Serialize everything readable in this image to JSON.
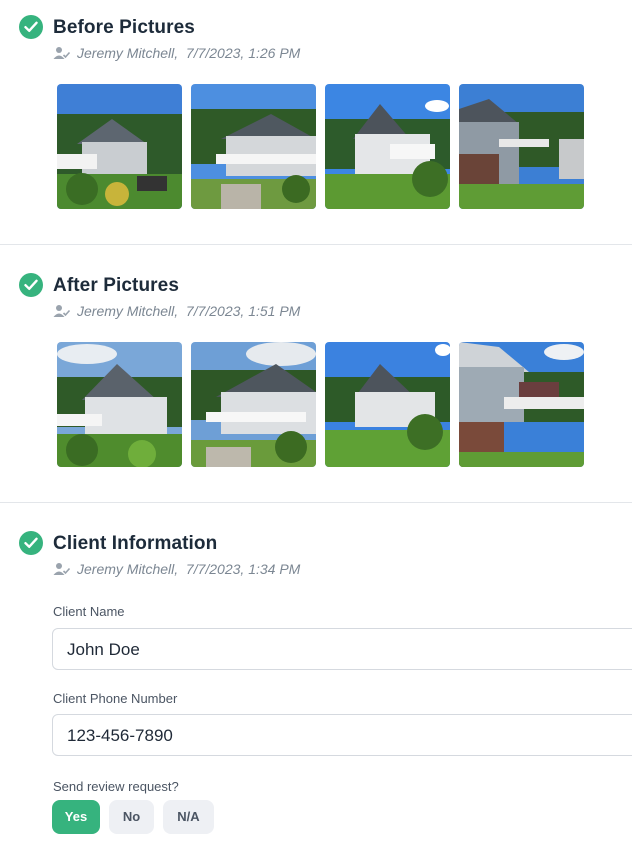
{
  "sections": [
    {
      "title": "Before Pictures",
      "author": "Jeremy Mitchell,",
      "timestamp": "7/7/2023, 1:26 PM",
      "photos": [
        "house-photo",
        "house-photo",
        "house-photo",
        "house-photo"
      ]
    },
    {
      "title": "After Pictures",
      "author": "Jeremy Mitchell,",
      "timestamp": "7/7/2023, 1:51 PM",
      "photos": [
        "house-photo",
        "house-photo",
        "house-photo",
        "house-photo"
      ]
    }
  ],
  "client": {
    "title": "Client Information",
    "author": "Jeremy Mitchell,",
    "timestamp": "7/7/2023, 1:34 PM",
    "name_label": "Client Name",
    "name_value": "John Doe",
    "phone_label": "Client Phone Number",
    "phone_value": "123-456-7890",
    "review_label": "Send review request?",
    "options": [
      "Yes",
      "No",
      "N/A"
    ],
    "selected": "Yes"
  },
  "colors": {
    "accent": "#36b37e",
    "text": "#1d2b3a",
    "muted": "#7c8793",
    "divider": "#e3e6ea"
  }
}
